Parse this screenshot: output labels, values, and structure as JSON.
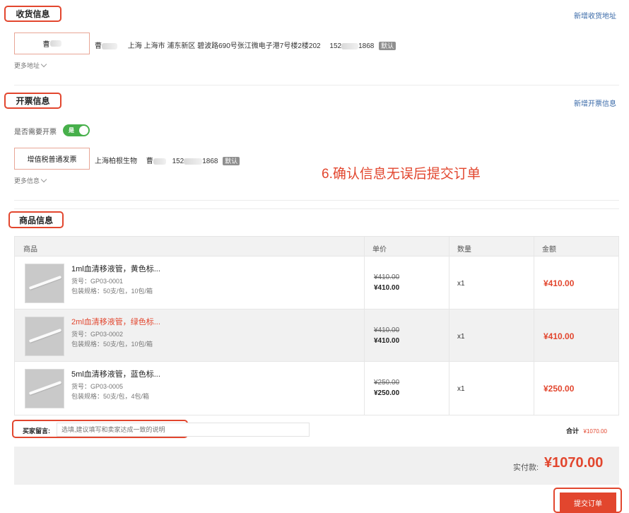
{
  "shipping": {
    "title": "收货信息",
    "add_link": "新增收货地址",
    "selected_name": "曹",
    "recipient": "曹",
    "address": "上海 上海市 浦东新区 碧波路690号张江微电子港7号楼2楼202",
    "phone_prefix": "152",
    "phone_suffix": "1868",
    "default_badge": "默认",
    "more_label": "更多地址"
  },
  "invoice": {
    "title": "开票信息",
    "add_link": "新增开票信息",
    "need_label": "是否需要开票",
    "toggle_label": "是",
    "type_button": "增值税普通发票",
    "company": "上海柏根生物",
    "contact": "曹",
    "phone_prefix": "152",
    "phone_suffix": "1868",
    "default_badge": "默认",
    "more_label": "更多信息"
  },
  "annotation": "6.确认信息无误后提交订单",
  "goods": {
    "title": "商品信息",
    "headers": [
      "商品",
      "单价",
      "数量",
      "金额"
    ],
    "rows": [
      {
        "name": "1ml血清移液管，黄色标...",
        "sku": "货号：GP03-0001",
        "pack": "包装规格：50支/包，10包/箱",
        "old_price": "¥410.00",
        "price": "¥410.00",
        "qty": "x1",
        "amount": "¥410.00",
        "highlight": false
      },
      {
        "name": "2ml血清移液管，绿色标...",
        "sku": "货号：GP03-0002",
        "pack": "包装规格：50支/包，10包/箱",
        "old_price": "¥410.00",
        "price": "¥410.00",
        "qty": "x1",
        "amount": "¥410.00",
        "highlight": true
      },
      {
        "name": "5ml血清移液管，蓝色标...",
        "sku": "货号：GP03-0005",
        "pack": "包装规格：50支/包，4包/箱",
        "old_price": "¥250.00",
        "price": "¥250.00",
        "qty": "x1",
        "amount": "¥250.00",
        "highlight": false
      }
    ]
  },
  "message": {
    "label": "买家留言:",
    "placeholder": "选填,建议填写和卖家达成一致的说明"
  },
  "total": {
    "label": "合计",
    "value": "¥1070.00"
  },
  "payment": {
    "label": "实付款:",
    "value": "¥1070.00"
  },
  "submit_label": "提交订单",
  "colors": {
    "accent": "#e2462e",
    "toggle": "#47b04b",
    "link": "#3a6aa8"
  }
}
